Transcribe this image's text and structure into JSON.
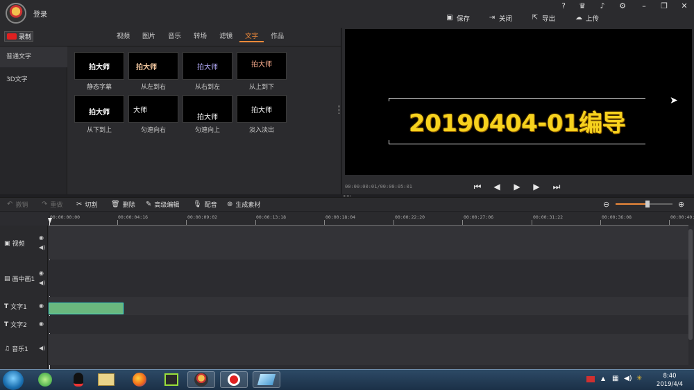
{
  "header": {
    "login": "登录",
    "actions": [
      {
        "label": "保存",
        "icon": "save-icon"
      },
      {
        "label": "关闭",
        "icon": "close-icon"
      },
      {
        "label": "导出",
        "icon": "export-icon"
      },
      {
        "label": "上传",
        "icon": "upload-icon"
      }
    ],
    "window_icons": [
      "?",
      "shop-icon",
      "bell-icon",
      "gear-icon",
      "minimize-icon",
      "restore-icon",
      "close-icon"
    ]
  },
  "record": {
    "label": "录制"
  },
  "tabs": [
    {
      "label": "视频"
    },
    {
      "label": "图片"
    },
    {
      "label": "音乐"
    },
    {
      "label": "转场"
    },
    {
      "label": "滤镜"
    },
    {
      "label": "文字",
      "active": true
    },
    {
      "label": "作品"
    }
  ],
  "sidebar": {
    "items": [
      {
        "label": "普通文字",
        "active": true
      },
      {
        "label": "3D文字"
      }
    ]
  },
  "text_styles": [
    {
      "thumb": "拍大师",
      "caption": "静态字幕"
    },
    {
      "thumb": "拍大师",
      "caption": "从左到右"
    },
    {
      "thumb": "拍大师",
      "caption": "从右到左"
    },
    {
      "thumb": "拍大师",
      "caption": "从上到下"
    },
    {
      "thumb": "拍大师",
      "caption": "从下到上"
    },
    {
      "thumb": "大师",
      "caption": "匀速向右"
    },
    {
      "thumb": "拍大师",
      "caption": "匀速向上"
    },
    {
      "thumb": "拍大师",
      "caption": "淡入淡出"
    }
  ],
  "preview": {
    "text": "20190404-01编导",
    "timecode": "00:00:00:01/00:00:05:01"
  },
  "edit_toolbar": [
    {
      "label": "撤销",
      "icon": "undo-icon",
      "enabled": false
    },
    {
      "label": "重做",
      "icon": "redo-icon",
      "enabled": false
    },
    {
      "label": "切割",
      "icon": "scissors-icon",
      "enabled": true
    },
    {
      "label": "删除",
      "icon": "trash-icon",
      "enabled": true
    },
    {
      "label": "高级编辑",
      "icon": "pencil-icon",
      "enabled": true
    },
    {
      "label": "配音",
      "icon": "mic-icon",
      "enabled": true
    },
    {
      "label": "生成素材",
      "icon": "film-reel-icon",
      "enabled": true
    }
  ],
  "timeline": {
    "ruler": [
      "00:00:00:00",
      "00:00:04:16",
      "00:00:09:02",
      "00:00:13:18",
      "00:00:18:04",
      "00:00:22:20",
      "00:00:27:06",
      "00:00:31:22",
      "00:00:36:08",
      "00:00:40:"
    ],
    "zoom_level": 0.56,
    "tracks": [
      {
        "label": "视频",
        "icon": "video-icon"
      },
      {
        "label": "画中画1",
        "icon": "pip-icon"
      },
      {
        "label": "文字1",
        "icon": "text-icon"
      },
      {
        "label": "文字2",
        "icon": "text-icon"
      },
      {
        "label": "音乐1",
        "icon": "music-icon"
      }
    ]
  },
  "taskbar": {
    "time": "8:40",
    "date": "2019/4/4"
  },
  "colors": {
    "accent": "#f08a3a",
    "preview_text": "#f6d21e",
    "clip": "#6ab87e"
  }
}
